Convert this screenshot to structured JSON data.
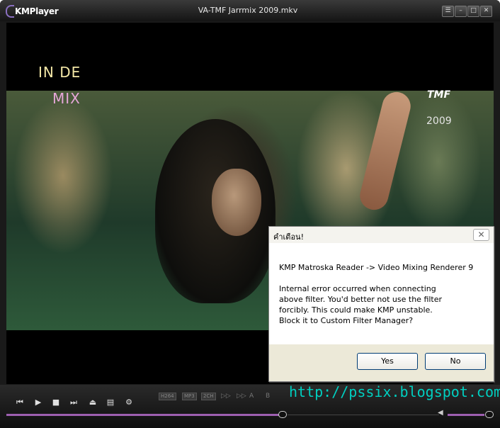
{
  "app": {
    "name": "KMPlayer",
    "window_title": "VA-TMF Jarrmix 2009.mkv"
  },
  "title_buttons": {
    "menu_icon": "menu-icon",
    "minimize_icon": "minimize-icon",
    "maximize_icon": "maximize-icon",
    "close_icon": "close-icon"
  },
  "video_overlay": {
    "line1": "IN DE",
    "line2": "MIX",
    "channel": "TMF",
    "year": "2009"
  },
  "dialog": {
    "title": "คำเตือน!",
    "line1": "KMP Matroska Reader -> Video Mixing Renderer 9",
    "line2": "Internal error occurred when connecting",
    "line3": "above filter. You'd better not use the filter",
    "line4": "forcibly. This could make KMP unstable.",
    "line5": "Block it to Custom Filter Manager?",
    "yes": "Yes",
    "no": "No"
  },
  "controls": {
    "icons": [
      "prev-icon",
      "play-icon",
      "stop-icon",
      "next-icon",
      "eject-icon",
      "playlist-icon",
      "settings-icon"
    ],
    "codec_video": "H264",
    "codec_audio": "MP3",
    "channels": "2CH",
    "ab_a": "A",
    "ab_b": "B",
    "watermark": "http://pssix.blogspot.com",
    "seek_progress": 0.56,
    "volume_level": 0.8,
    "accent": "#9d5fb0"
  }
}
